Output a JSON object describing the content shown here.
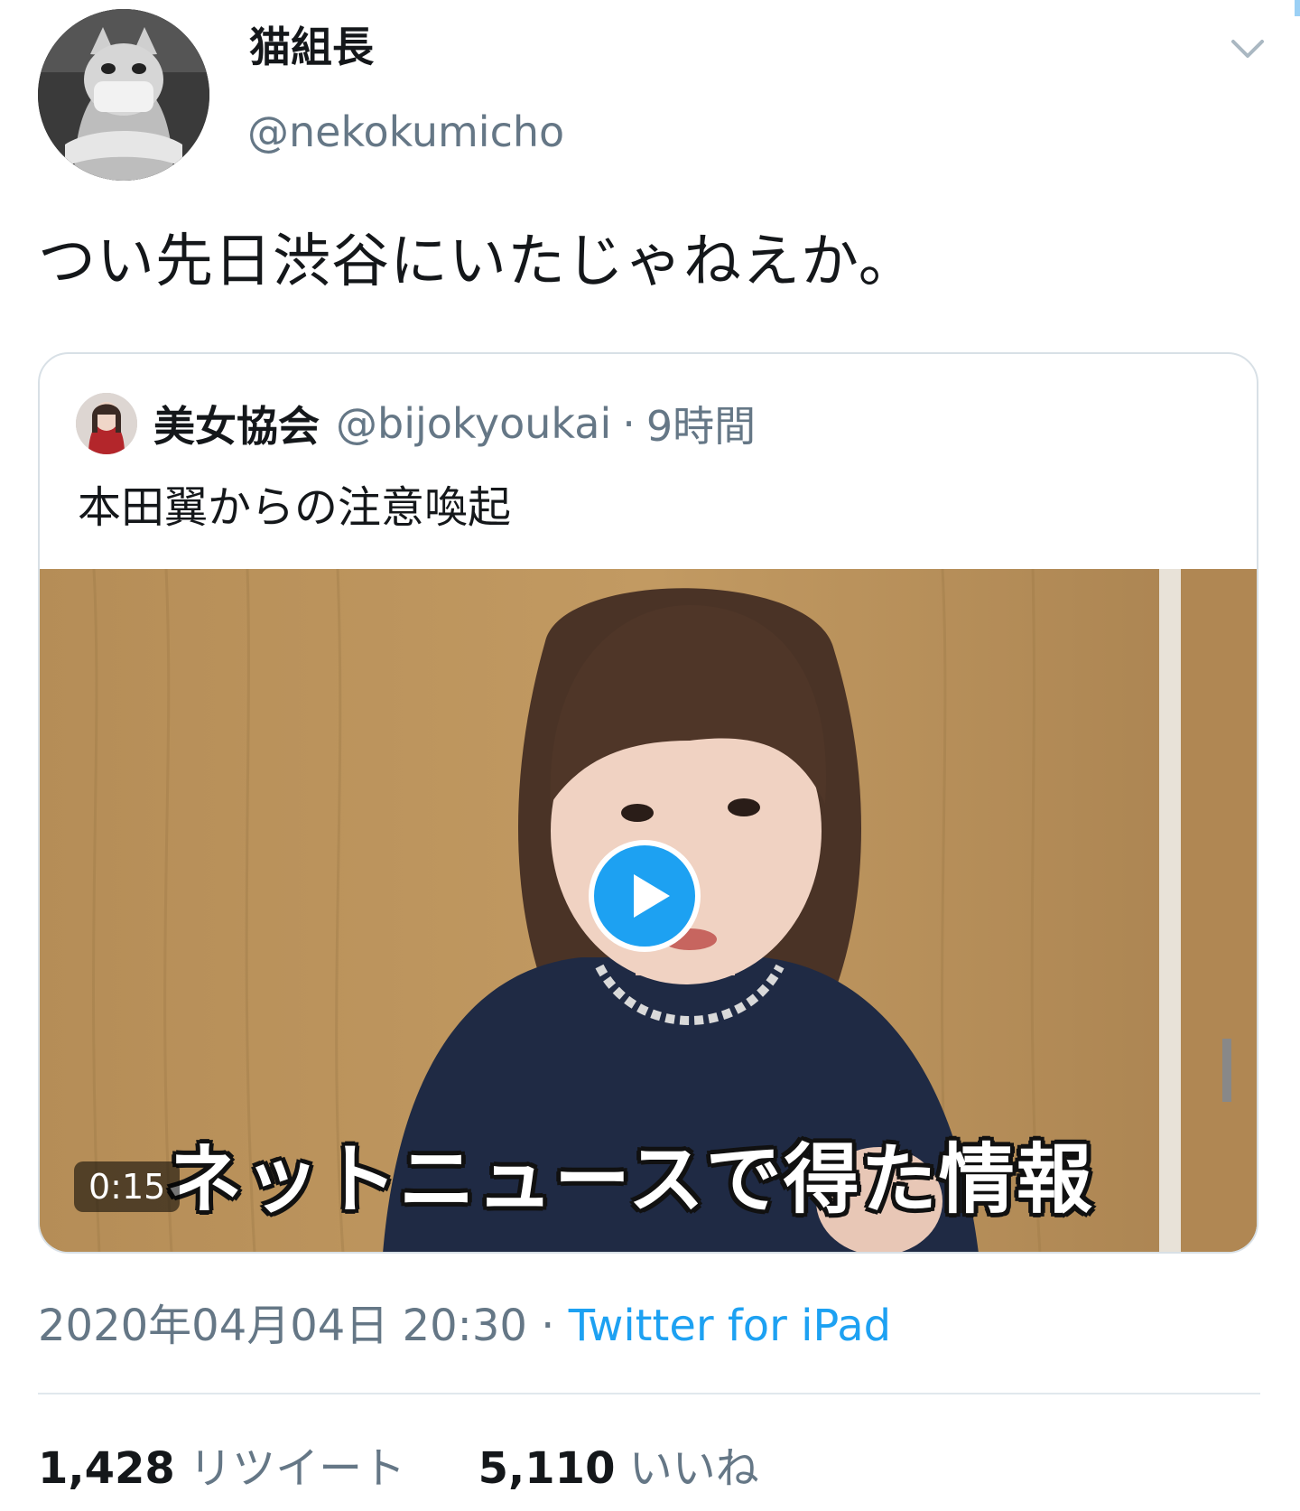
{
  "author": {
    "name": "猫組長",
    "handle": "@nekokumicho"
  },
  "tweet": {
    "text": "つい先日渋谷にいたじゃねえか。"
  },
  "quoted": {
    "name": "美女協会",
    "handle": "@bijokyoukai",
    "separator": "·",
    "time": "9時間",
    "text": "本田翼からの注意喚起",
    "video": {
      "caption": "ネットニュースで得た情報",
      "duration": "0:15"
    }
  },
  "meta": {
    "datetime": "2020年04月04日 20:30",
    "separator": "·",
    "source": "Twitter for iPad"
  },
  "stats": {
    "retweets_count": "1,428",
    "retweets_label": "リツイート",
    "likes_count": "5,110",
    "likes_label": "いいね"
  },
  "icons": {
    "menu": "chevron-down-icon",
    "play": "play-icon"
  },
  "colors": {
    "accent": "#1da1f2",
    "secondary_text": "#657786",
    "primary_text": "#14171a",
    "border": "#d8e0e6"
  }
}
